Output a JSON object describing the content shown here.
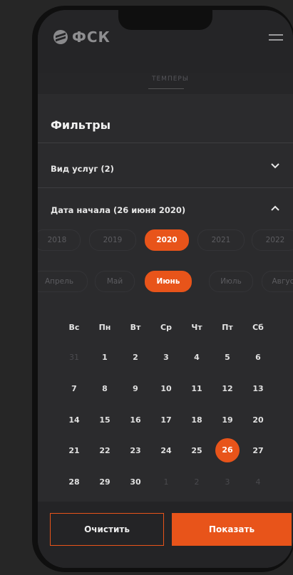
{
  "header": {
    "logo_text": "ФСК",
    "menu_icon": "hamburger-icon"
  },
  "background_tabs": {
    "active_tab": "ТЕМПЕРЫ"
  },
  "filters": {
    "title": "Фильтры",
    "services": {
      "label": "Вид услуг (2)",
      "icon": "chevron-down-icon"
    },
    "start_date": {
      "label": "Дата начала (26 июня 2020)",
      "icon": "chevron-up-icon"
    }
  },
  "years": [
    "2018",
    "2019",
    "2020",
    "2021",
    "2022"
  ],
  "selected_year": "2020",
  "months": [
    "Апрель",
    "Май",
    "Июнь",
    "Июль",
    "Август"
  ],
  "selected_month": "Июнь",
  "calendar": {
    "weekdays": [
      "Вс",
      "Пн",
      "Вт",
      "Ср",
      "Чт",
      "Пт",
      "Сб"
    ],
    "weeks": [
      [
        "31",
        "1",
        "2",
        "3",
        "4",
        "5",
        "6"
      ],
      [
        "7",
        "8",
        "9",
        "10",
        "11",
        "12",
        "13"
      ],
      [
        "14",
        "15",
        "16",
        "17",
        "18",
        "19",
        "20"
      ],
      [
        "21",
        "22",
        "23",
        "24",
        "25",
        "26",
        "27"
      ],
      [
        "28",
        "29",
        "30",
        "1",
        "2",
        "3",
        "4"
      ]
    ],
    "selected_day": "26"
  },
  "actions": {
    "clear_label": "Очистить",
    "show_label": "Показать"
  },
  "colors": {
    "accent": "#e8541a",
    "panel": "#2b2b2d",
    "background": "#262626"
  }
}
